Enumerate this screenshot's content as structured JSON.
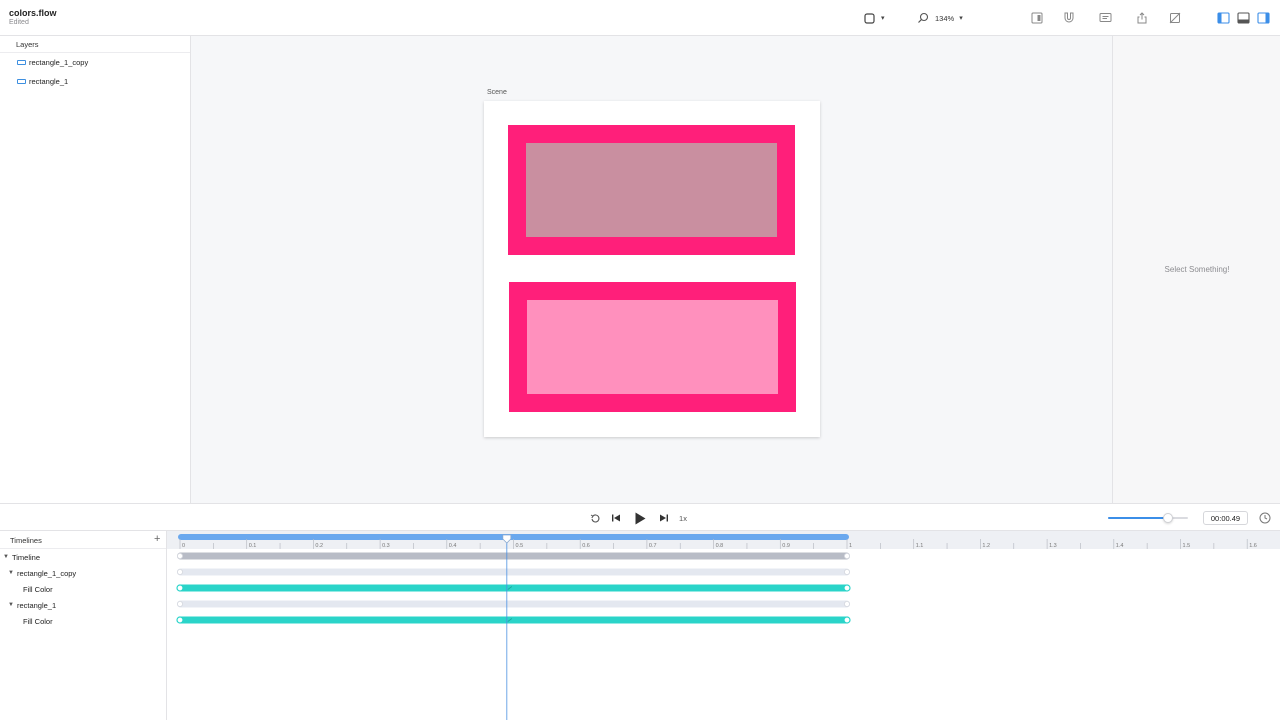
{
  "document": {
    "title": "colors.flow",
    "status": "Edited"
  },
  "toolbar": {
    "shape_tool_icon": "square-icon",
    "zoom_level": "134%"
  },
  "layers": {
    "header": "Layers",
    "items": [
      {
        "label": "rectangle_1_copy",
        "icon": "rectangle-icon"
      },
      {
        "label": "rectangle_1",
        "icon": "rectangle-icon"
      }
    ]
  },
  "canvas": {
    "scene_label": "Scene",
    "colors": {
      "rect_stroke": "#ff1f7a",
      "rect_top_fill": "#c98fa0",
      "rect_bottom_fill": "#ff90bd"
    }
  },
  "inspector": {
    "empty_message": "Select Something!"
  },
  "playback": {
    "speed": "1x",
    "current_time": "00:00.49",
    "volume_level": 0.75
  },
  "timelines": {
    "header": "Timelines",
    "add_label": "+",
    "rows": [
      {
        "label": "Timeline"
      },
      {
        "label": "rectangle_1_copy"
      },
      {
        "label": "Fill Color"
      },
      {
        "label": "rectangle_1"
      },
      {
        "label": "Fill Color"
      }
    ],
    "ruler_labels": [
      "0",
      "0.1",
      "0.2",
      "0.3",
      "0.4",
      "0.5",
      "0.6",
      "0.7",
      "0.8",
      "0.9",
      "1",
      "1.1",
      "1.2",
      "1.3",
      "1.4",
      "1.5",
      "1.6"
    ],
    "playhead_time": 0.49,
    "duration": 1,
    "colors": {
      "ruler_active": "#6aa8ee",
      "track_active": "#2ad4c9",
      "track_timeline": "#b8bcc6",
      "track_group": "#e4e8f0",
      "playhead": "#4a90e2"
    }
  }
}
